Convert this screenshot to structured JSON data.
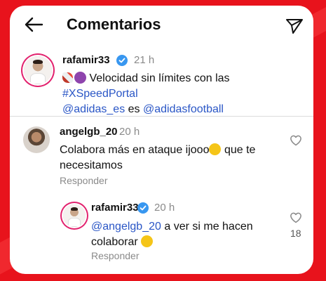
{
  "header": {
    "title": "Comentarios"
  },
  "caption": {
    "username": "rafamir33",
    "time": "21 h",
    "text": "Velocidad sin límites con las",
    "hashtag": "#XSpeedPortal",
    "mention1": "@adidas_es",
    "connector": "es",
    "mention2": "@adidasfootball"
  },
  "comment": {
    "username": "angelgb_20",
    "time": "20 h",
    "text_part1": "Colabora más en ataque ijooo",
    "text_part2": "que te",
    "text_part3": "necesitamos",
    "reply_label": "Responder"
  },
  "reply": {
    "username": "rafamir33",
    "time": "20 h",
    "mention": "@angelgb_20",
    "text_part1": "a ver si me hacen",
    "text_part2": "colaborar",
    "reply_label": "Responder",
    "likes": "18"
  },
  "colors": {
    "accent": "#2a56c6",
    "verified": "#3897f0",
    "background": "#e8131c"
  }
}
